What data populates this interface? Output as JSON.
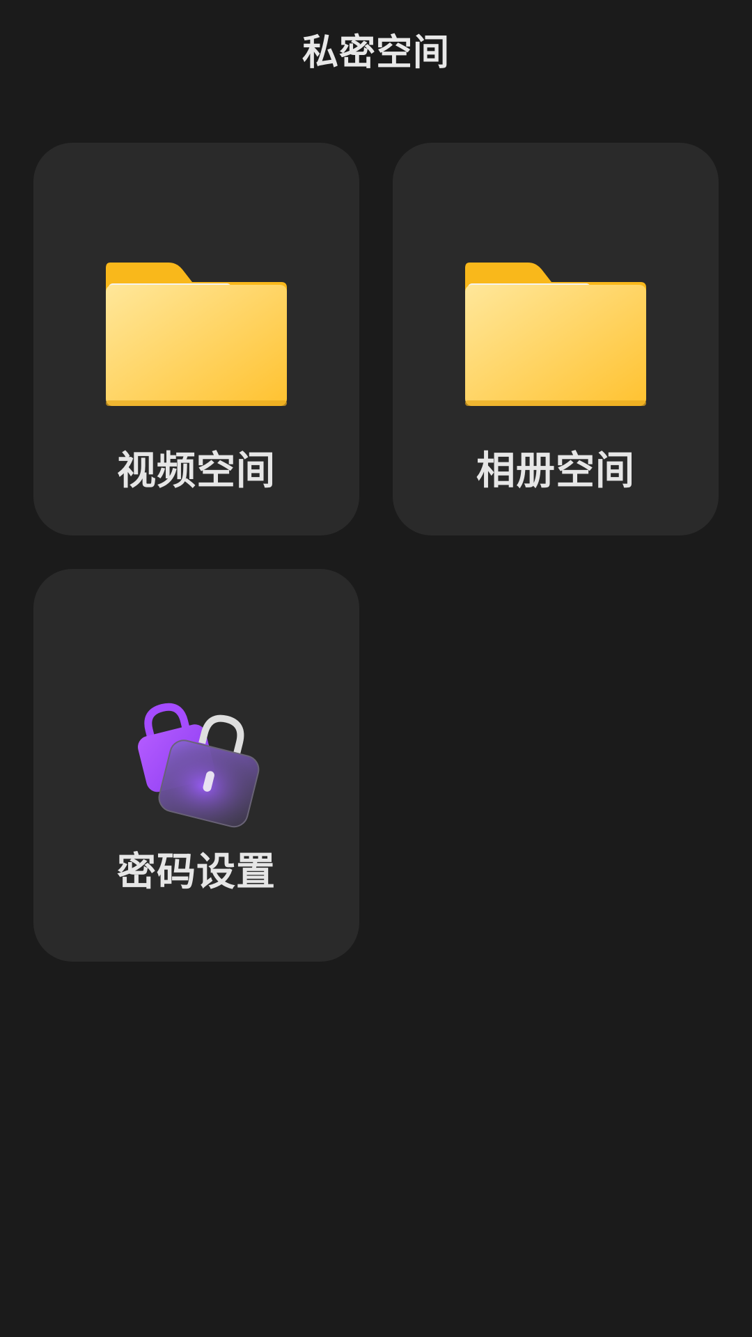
{
  "header": {
    "title": "私密空间"
  },
  "cards": [
    {
      "label": "视频空间",
      "icon": "folder-icon"
    },
    {
      "label": "相册空间",
      "icon": "folder-icon"
    },
    {
      "label": "密码设置",
      "icon": "lock-icon"
    }
  ],
  "colors": {
    "background": "#1b1b1b",
    "card": "#2a2a2a",
    "text": "#e6e6e6",
    "folder": "#ffc93a",
    "lock_accent": "#9b4dff"
  }
}
